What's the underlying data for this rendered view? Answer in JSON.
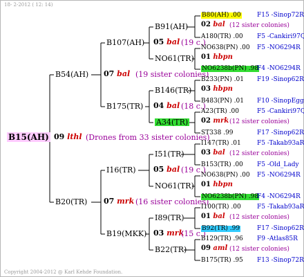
{
  "header": {
    "date": "18-  2-2012 ( 12: 14)"
  },
  "footer": {
    "copyright": "Copyright 2004-2012 @ Karl Kehde Foundation."
  },
  "root": {
    "label": "B15(AH)",
    "gen": "09",
    "ann": "lthl",
    "note": "(Drones from 33 sister colonies)"
  },
  "level1": {
    "upper": {
      "label": "B54(AH)",
      "gen": "07",
      "ann": "bal",
      "note": "(19 sister colonies)"
    },
    "lower": {
      "label": "B20(TR)",
      "gen": "07",
      "ann": "mrk",
      "note": "(16 sister colonies)"
    }
  },
  "level2": {
    "a": {
      "label": "B107(AH)",
      "gen": "05",
      "ann": "bal",
      "note": "(19 c.)"
    },
    "b": {
      "label": "B175(TR)",
      "gen": "04",
      "ann": "bal",
      "note": "(18 c.)"
    },
    "c": {
      "label": "I16(TR)",
      "gen": "05",
      "ann": "bal",
      "note": "(19 c.)"
    },
    "d": {
      "label": "B19(MKK)",
      "gen": "03",
      "ann": "mrk",
      "note": "(15 c.)"
    }
  },
  "level3": {
    "a1": "B91(AH)",
    "a2": "NO61(TR)",
    "b1": "B146(TR)",
    "b2": "A34(TR)",
    "c1": "I51(TR)",
    "c2": "NO61(TR)",
    "d1": "I89(TR)",
    "d2": "B22(TR)"
  },
  "leaves": [
    {
      "left": "B80(AH) .00",
      "right": "F15 -Sinop72R"
    },
    {
      "gen": "02",
      "ann": "bal",
      "note": "(12 sister colonies)"
    },
    {
      "left": "A180(TR) .00",
      "right": "F5 -Cankiri97Q"
    },
    {
      "left": "NO638(PN) .00",
      "right": "F5 -NO6294R"
    },
    {
      "gen": "01",
      "ann": "hbpn",
      "note": ""
    },
    {
      "left": "NO6238b(PN) .98",
      "right": "F4 -NO6294R"
    },
    {
      "left": "B233(PN) .01",
      "right": "F19 -Sinop62R"
    },
    {
      "gen": "03",
      "ann": "hbpn",
      "note": ""
    },
    {
      "left": "B483(PN) .01",
      "right": "F10 -SinopEgg86R"
    },
    {
      "left": "A23(TR) .00",
      "right": "F5 -Cankiri97Q"
    },
    {
      "gen": "02",
      "ann": "mrk",
      "note": "(12 sister colonies)"
    },
    {
      "left": "ST338 .99",
      "right": "F17 -Sinop62R"
    },
    {
      "left": "I147(TR) .01",
      "right": "F5 -Takab93aR"
    },
    {
      "gen": "03",
      "ann": "bal",
      "note": "(12 sister colonies)"
    },
    {
      "left": "B153(TR) .00",
      "right": "F5 -Old_Lady"
    },
    {
      "left": "NO638(PN) .00",
      "right": "F5 -NO6294R"
    },
    {
      "gen": "01",
      "ann": "hbpn",
      "note": ""
    },
    {
      "left": "NO6238b(PN) .98",
      "right": "F4 -NO6294R"
    },
    {
      "left": "I100(TR) .00",
      "right": "F5 -Takab93aR"
    },
    {
      "gen": "01",
      "ann": "bal",
      "note": "(12 sister colonies)"
    },
    {
      "left": "B92(TR) .99",
      "right": "F17 -Sinop62R"
    },
    {
      "left": "B129(TR) .96",
      "right": "F9 -Atlas85R"
    },
    {
      "gen": "09",
      "ann": "aml",
      "note": "(12 sister colonies)"
    },
    {
      "left": "B175(TR) .95",
      "right": "F13 -Sinop72R"
    }
  ]
}
